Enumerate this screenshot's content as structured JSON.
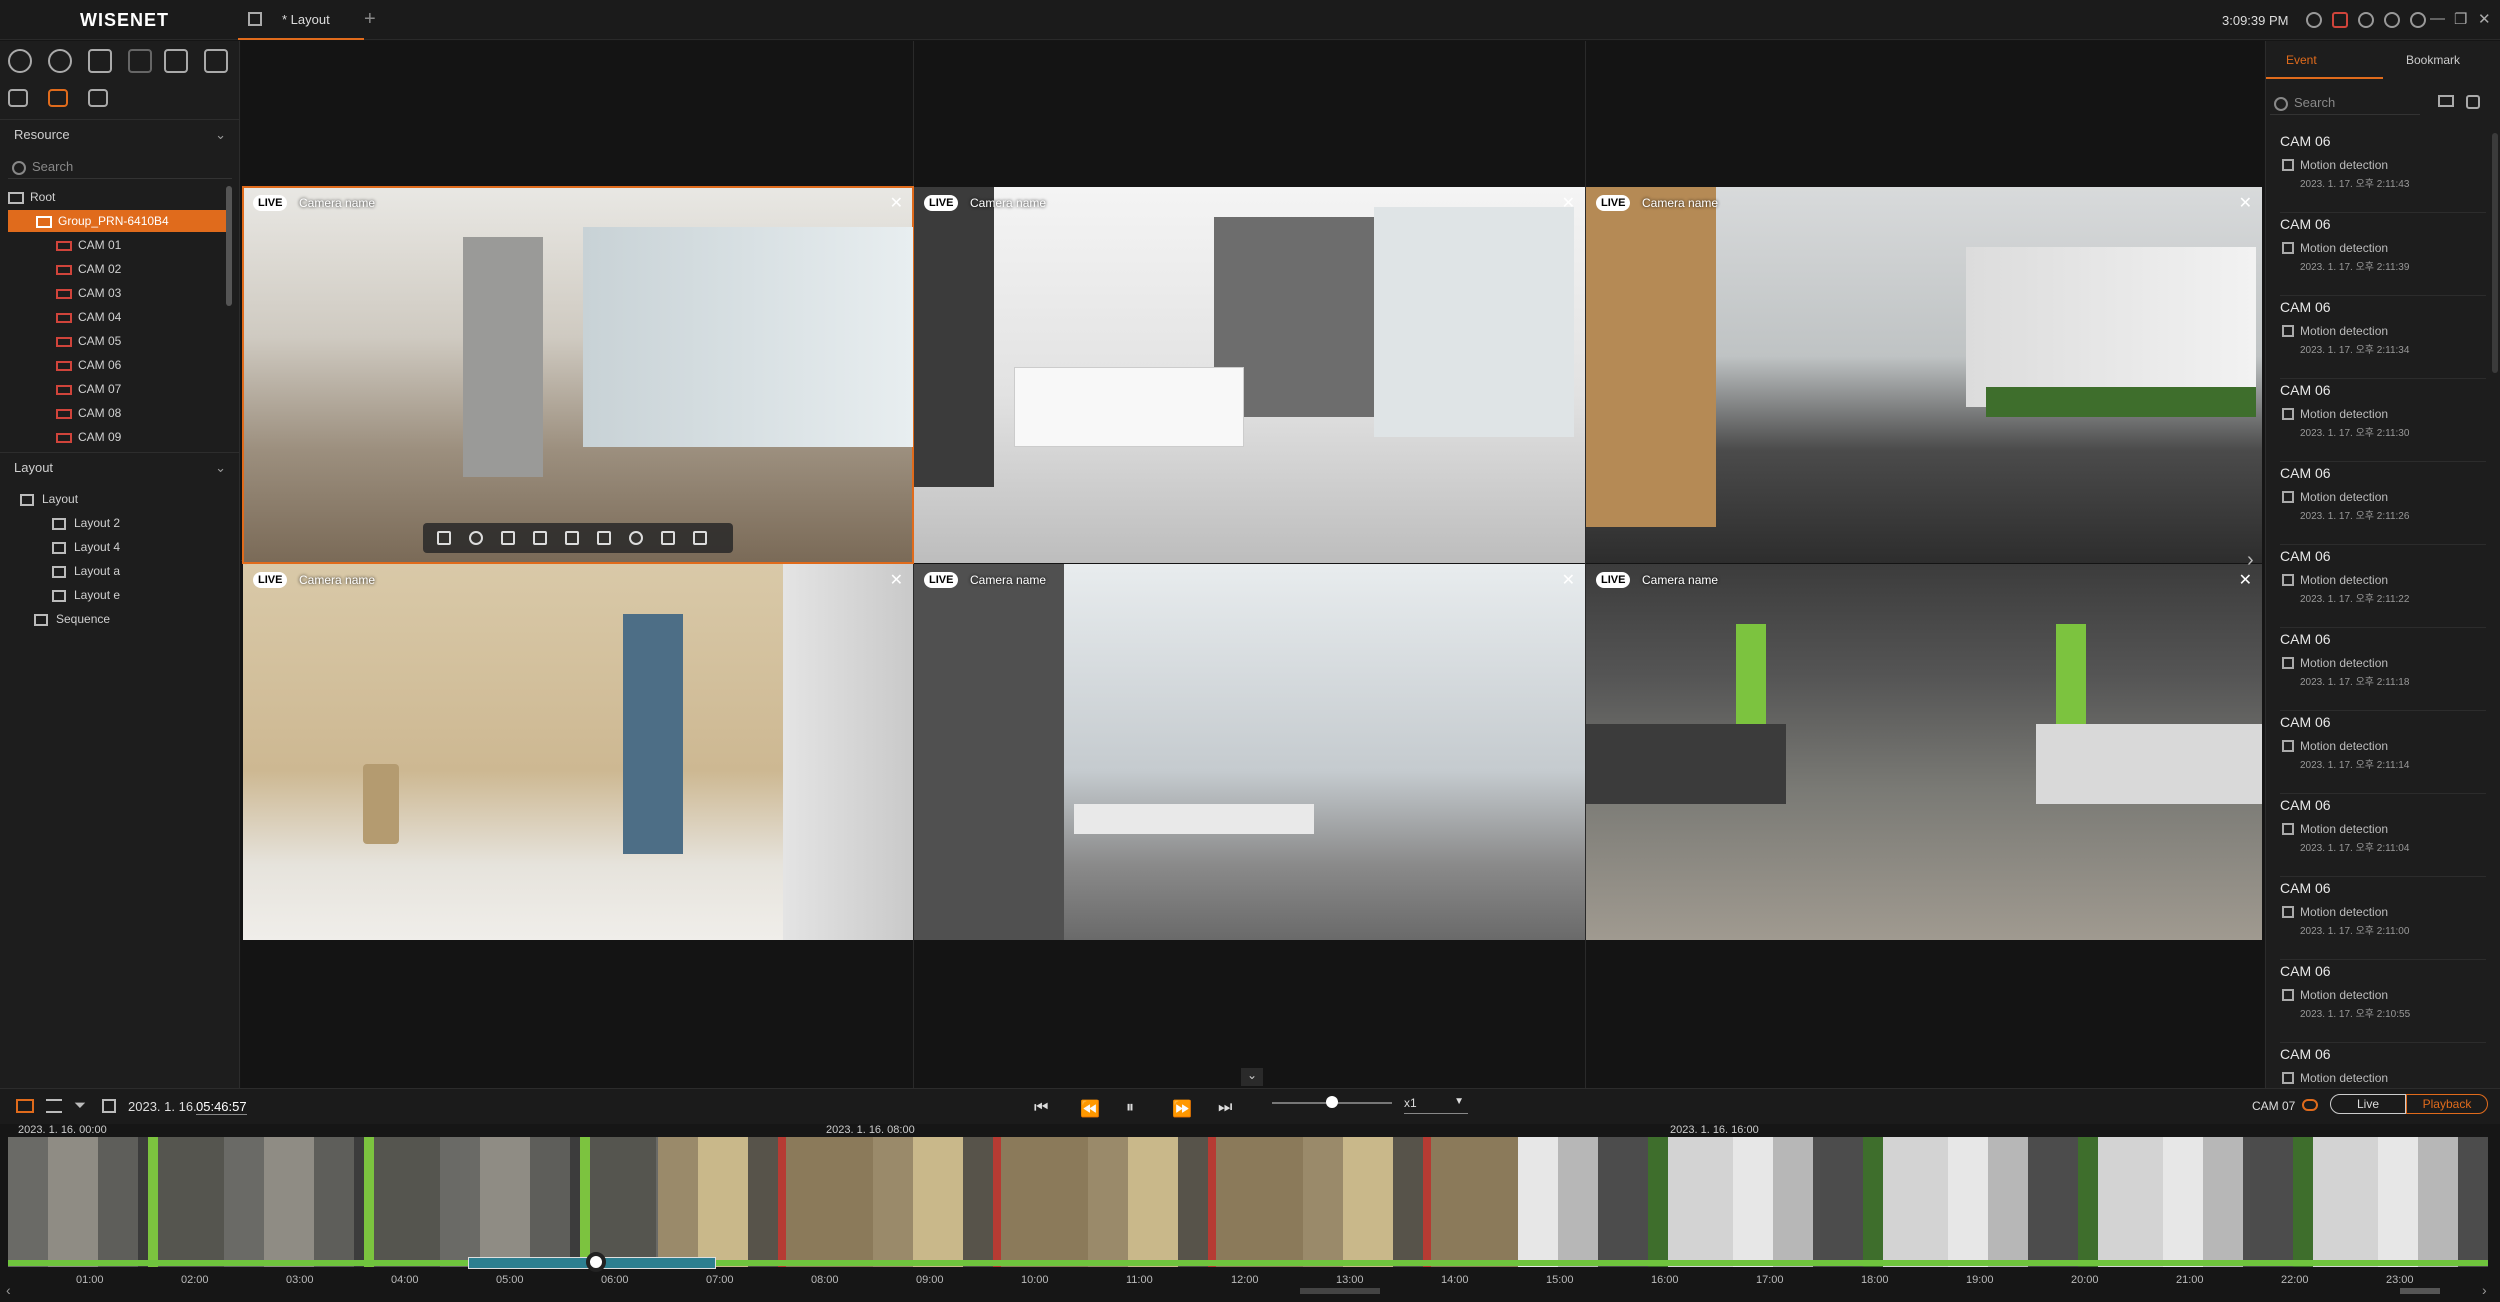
{
  "app": {
    "logo": "WISENET",
    "tab_label": "* Layout",
    "tab_add": "+",
    "clock": "3:09:39 PM",
    "win_min": "—",
    "win_restore": "❐",
    "win_close": "✕"
  },
  "sidebar": {
    "resource_title": "Resource",
    "layout_title": "Layout",
    "search_placeholder": "Search",
    "root": "Root",
    "group": "Group_PRN-6410B4",
    "cams": [
      "CAM 01",
      "CAM 02",
      "CAM 03",
      "CAM 04",
      "CAM 05",
      "CAM 06",
      "CAM 07",
      "CAM 08",
      "CAM 09"
    ],
    "layouts": [
      "Layout",
      "Layout 2",
      "Layout 4",
      "Layout a",
      "Layout e"
    ],
    "sequence": "Sequence"
  },
  "tiles": {
    "live": "LIVE",
    "camera_name": "Camera name",
    "close": "✕"
  },
  "rightpanel": {
    "tab_event": "Event",
    "tab_bookmark": "Bookmark",
    "search_placeholder": "Search",
    "events": [
      {
        "cam": "CAM 06",
        "type": "Motion detection",
        "time": "2023. 1. 17. 오후 2:11:43"
      },
      {
        "cam": "CAM 06",
        "type": "Motion detection",
        "time": "2023. 1. 17. 오후 2:11:39"
      },
      {
        "cam": "CAM 06",
        "type": "Motion detection",
        "time": "2023. 1. 17. 오후 2:11:34"
      },
      {
        "cam": "CAM 06",
        "type": "Motion detection",
        "time": "2023. 1. 17. 오후 2:11:30"
      },
      {
        "cam": "CAM 06",
        "type": "Motion detection",
        "time": "2023. 1. 17. 오후 2:11:26"
      },
      {
        "cam": "CAM 06",
        "type": "Motion detection",
        "time": "2023. 1. 17. 오후 2:11:22"
      },
      {
        "cam": "CAM 06",
        "type": "Motion detection",
        "time": "2023. 1. 17. 오후 2:11:18"
      },
      {
        "cam": "CAM 06",
        "type": "Motion detection",
        "time": "2023. 1. 17. 오후 2:11:14"
      },
      {
        "cam": "CAM 06",
        "type": "Motion detection",
        "time": "2023. 1. 17. 오후 2:11:04"
      },
      {
        "cam": "CAM 06",
        "type": "Motion detection",
        "time": "2023. 1. 17. 오후 2:11:00"
      },
      {
        "cam": "CAM 06",
        "type": "Motion detection",
        "time": "2023. 1. 17. 오후 2:10:55"
      },
      {
        "cam": "CAM 06",
        "type": "Motion detection",
        "time": ""
      }
    ]
  },
  "playback": {
    "date": "2023. 1. 16.",
    "time": "05:46:57",
    "speed": "x1",
    "cam_label": "CAM 07",
    "live": "Live",
    "playback": "Playback",
    "btn_first": "⏮",
    "btn_rew": "⏪",
    "btn_pause": "⏸",
    "btn_ff": "⏩",
    "btn_last": "⏭",
    "speed_level": 0.5
  },
  "timeline": {
    "dates": [
      "2023. 1. 16. 00:00",
      "2023. 1. 16. 08:00",
      "2023. 1. 16. 16:00"
    ],
    "hours": [
      "01:00",
      "02:00",
      "03:00",
      "04:00",
      "05:00",
      "06:00",
      "07:00",
      "08:00",
      "09:00",
      "10:00",
      "11:00",
      "12:00",
      "13:00",
      "14:00",
      "15:00",
      "16:00",
      "17:00",
      "18:00",
      "19:00",
      "20:00",
      "21:00",
      "22:00",
      "23:00"
    ],
    "nav_left": "‹",
    "nav_right": "›"
  },
  "colors": {
    "accent": "#e06b1c",
    "live_badge": "#ffffff",
    "timeline_green": "#6fc43d",
    "selection": "#2d7f90"
  }
}
